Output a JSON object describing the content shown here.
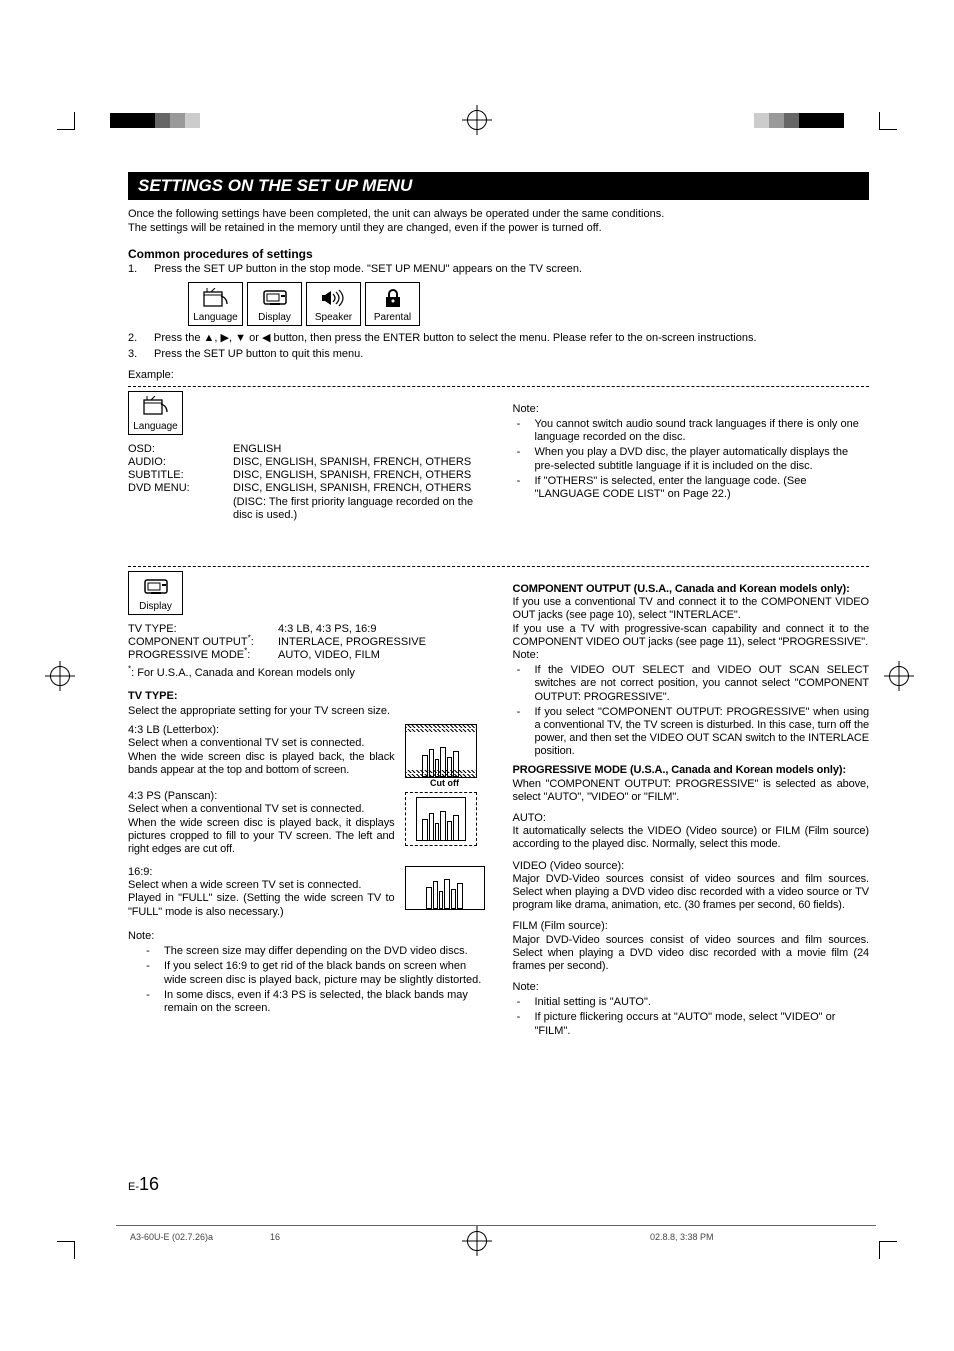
{
  "title": "SETTINGS ON THE SET UP MENU",
  "intro_line1": "Once the following settings have been completed, the unit can always be operated under the same conditions.",
  "intro_line2": "The settings will be retained in the memory until they are changed, even if the power is turned off.",
  "common_procedures_head": "Common procedures of settings",
  "steps": {
    "s1n": "1.",
    "s1t": "Press the SET UP button in the stop mode. \"SET UP MENU\" appears on the TV screen.",
    "s2n": "2.",
    "s2t_a": "Press the ",
    "s2t_b": " button, then press the ENTER button to select the menu. Please refer to the on-screen instructions.",
    "s3n": "3.",
    "s3t": "Press the SET UP button to quit this menu."
  },
  "arrows_sep": ", ",
  "arrows_or": " or ",
  "arrow_up": "▲",
  "arrow_right": "▶",
  "arrow_down": "▼",
  "arrow_left": "◀",
  "menu_labels": {
    "language": "Language",
    "display": "Display",
    "speaker": "Speaker",
    "parental": "Parental"
  },
  "example_label": "Example:",
  "language": {
    "box_label": "Language",
    "rows": [
      {
        "k": "OSD:",
        "v": "ENGLISH"
      },
      {
        "k": "AUDIO:",
        "v": "DISC, ENGLISH, SPANISH, FRENCH, OTHERS"
      },
      {
        "k": "SUBTITLE:",
        "v": "DISC, ENGLISH, SPANISH, FRENCH, OTHERS"
      },
      {
        "k": "DVD MENU:",
        "v": "DISC, ENGLISH, SPANISH, FRENCH, OTHERS"
      }
    ],
    "disc_note": "(DISC: The first priority language recorded on the disc is used.)",
    "note_head": "Note:",
    "notes": [
      "You cannot switch audio sound track languages if there is only one language recorded on the disc.",
      "When you play a DVD disc, the player automatically displays the pre-selected subtitle language if it is included on the disc.",
      "If \"OTHERS\" is selected, enter the language code. (See \"LANGUAGE CODE LIST\" on Page 22.)"
    ]
  },
  "display": {
    "box_label": "Display",
    "rows": [
      {
        "k": "TV TYPE:",
        "v": "4:3 LB, 4:3 PS, 16:9"
      },
      {
        "k": "COMPONENT OUTPUT",
        "v": "INTERLACE, PROGRESSIVE"
      },
      {
        "k": "PROGRESSIVE MODE",
        "v": "AUTO, VIDEO, FILM"
      }
    ],
    "ast_colon": ":",
    "footnote_mark": "*",
    "footnote": "For U.S.A., Canada and Korean models only",
    "tvtype_head": "TV TYPE:",
    "tvtype_sub": "Select the appropriate setting for your TV screen size.",
    "lb_head": "4:3 LB (Letterbox):",
    "lb_p1": "Select when a conventional TV set is connected.",
    "lb_p2": "When the wide screen disc is played back, the black bands appear at the top and bottom of screen.",
    "ps_head": "4:3 PS (Panscan):",
    "ps_p1": "Select when a conventional TV set is connected.",
    "ps_p2": "When the wide screen disc is played back, it displays pictures cropped to fill to your TV screen. The left and right edges are cut off.",
    "cutoff_label": "Cut off",
    "w169_head": "16:9:",
    "w169_p1": "Select when a wide screen TV set is connected.",
    "w169_p2": "Played in \"FULL\" size. (Setting the wide screen TV to \"FULL\" mode is also necessary.)",
    "note_head": "Note:",
    "notes_left": [
      "The screen size may differ depending on the DVD video discs.",
      "If you select 16:9 to get rid of the black bands on screen when wide screen disc is played back, picture may be slightly distorted.",
      "In some discs, even if 4:3 PS is selected, the black bands may remain on the screen."
    ],
    "comp_head": "COMPONENT OUTPUT (U.S.A., Canada and Korean models only):",
    "comp_p1": "If you use a conventional TV and connect it to the COMPONENT VIDEO OUT jacks (see page 10), select \"INTERLACE\".",
    "comp_p2": "If you use a TV with progressive-scan capability and connect it to the COMPONENT VIDEO OUT jacks (see page 11), select \"PROGRESSIVE\".",
    "comp_note_head": "Note:",
    "comp_notes": [
      "If the VIDEO OUT SELECT and VIDEO OUT SCAN SELECT switches are not correct position, you cannot select \"COMPONENT OUTPUT: PROGRESSIVE\".",
      "If you select \"COMPONENT OUTPUT: PROGRESSIVE\" when using a conventional TV, the TV screen is disturbed. In this case, turn off the power, and then set the VIDEO OUT SCAN switch to the INTERLACE position."
    ],
    "prog_head": "PROGRESSIVE MODE (U.S.A., Canada and Korean models only):",
    "prog_p1": "When \"COMPONENT OUTPUT: PROGRESSIVE\" is selected as above, select \"AUTO\", \"VIDEO\" or \"FILM\".",
    "auto_head": "AUTO:",
    "auto_p": "It automatically selects the VIDEO (Video source) or FILM (Film source) according to the played disc. Normally, select this mode.",
    "video_head": "VIDEO (Video source):",
    "video_p": "Major DVD-Video sources consist of video sources and film sources. Select when playing a DVD video disc recorded with a video source or TV program like drama, animation, etc. (30 frames per second, 60 fields).",
    "film_head": "FILM (Film source):",
    "film_p": "Major DVD-Video sources consist of video sources and film sources. Select when playing a DVD video disc recorded with a movie film (24 frames per second).",
    "note2_head": "Note:",
    "notes2": [
      "Initial setting is \"AUTO\".",
      "If picture flickering occurs at \"AUTO\" mode, select \"VIDEO\" or \"FILM\"."
    ]
  },
  "page_prefix": "E-",
  "page_number": "16",
  "footer_file": "A3-60U-E (02.7.26)a",
  "footer_page": "16",
  "footer_date": "02.8.8, 3:38 PM"
}
